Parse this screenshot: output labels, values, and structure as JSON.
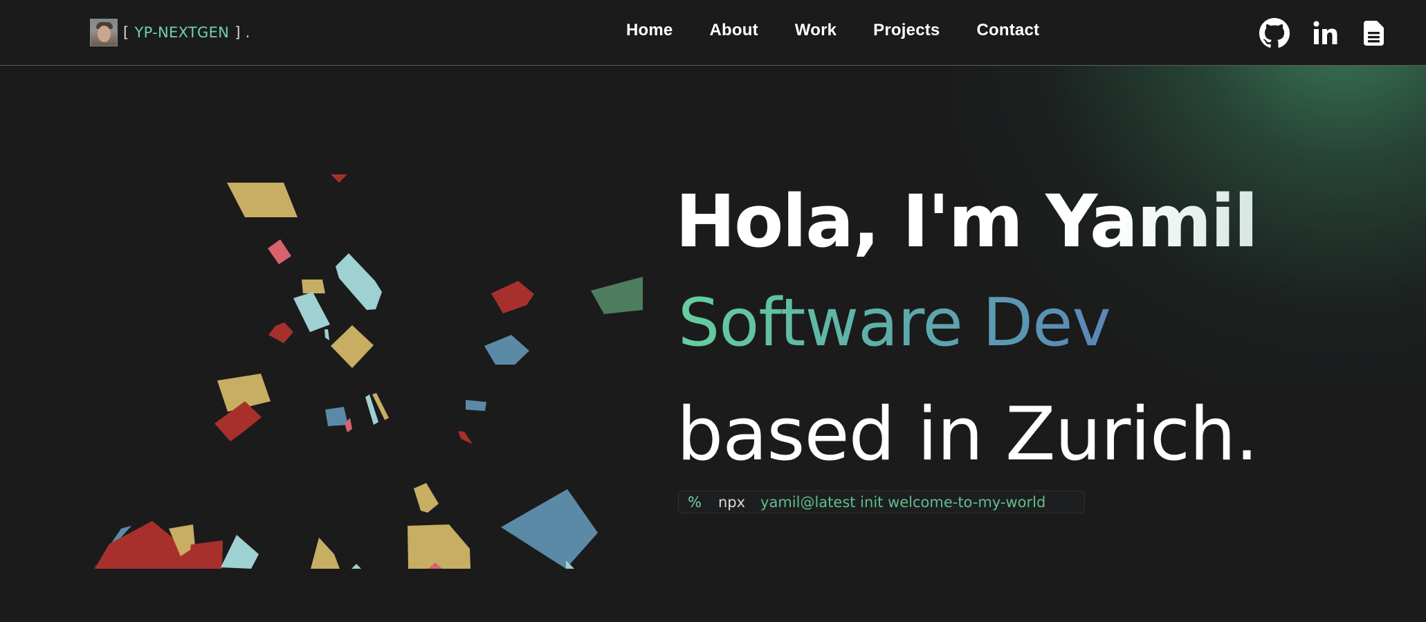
{
  "brand": {
    "bracket_open": "[",
    "name": "YP-NEXTGEN",
    "bracket_close": "] ."
  },
  "nav": {
    "items": [
      {
        "label": "Home"
      },
      {
        "label": "About"
      },
      {
        "label": "Work"
      },
      {
        "label": "Projects"
      },
      {
        "label": "Contact"
      }
    ]
  },
  "social": [
    "github-icon",
    "linkedin-icon",
    "document-icon"
  ],
  "hero": {
    "greeting": "Hola, I'm Yamil",
    "role": "Software Dev",
    "location": "based in Zurich."
  },
  "terminal": {
    "prompt": "%",
    "command": "npx",
    "args": "yamil@latest init welcome-to-my-world"
  },
  "colors": {
    "background": "#1b1b1c",
    "accent_green": "#6fd3a5",
    "gold": "#c7ae63",
    "red": "#a8302c",
    "light_blue": "#9fd0d2",
    "steel_blue": "#5b8aa6",
    "pink": "#d8636f",
    "sage": "#4e7d5e"
  }
}
